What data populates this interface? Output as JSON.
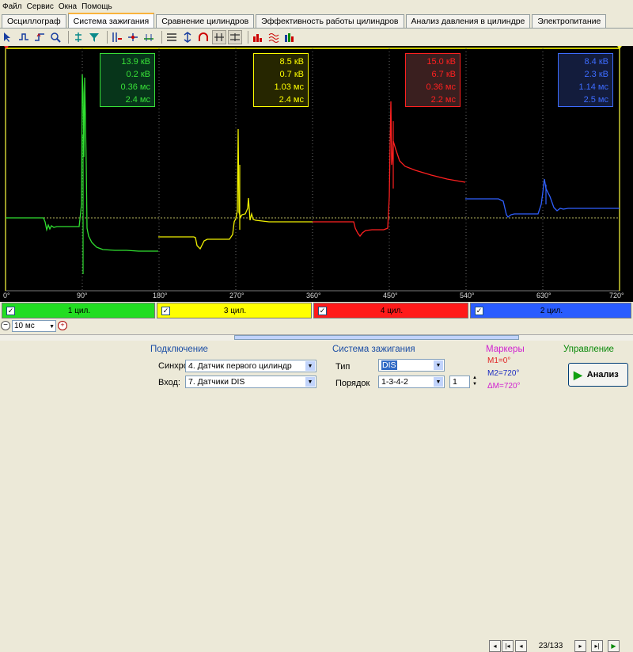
{
  "menu": [
    "Файл",
    "Сервис",
    "Окна",
    "Помощь"
  ],
  "tabs": [
    "Осциллограф",
    "Система зажигания",
    "Сравнение цилиндров",
    "Эффективность работы цилиндров",
    "Анализ давления в цилиндре",
    "Электропитание"
  ],
  "active_tab": 1,
  "measurements": [
    {
      "color": "#38e038",
      "lines": [
        "13.9 кВ",
        "0.2 кВ",
        "0.36 мс",
        "2.4 мс"
      ]
    },
    {
      "color": "#ffff00",
      "lines": [
        "8.5 кВ",
        "0.7 кВ",
        "1.03 мс",
        "2.4 мс"
      ]
    },
    {
      "color": "#ff2020",
      "lines": [
        "15.0 кВ",
        "6.7 кВ",
        "0.36 мс",
        "2.2 мс"
      ]
    },
    {
      "color": "#3d6cff",
      "lines": [
        "8.4 кВ",
        "2.3 кВ",
        "1.14 мс",
        "2.5 мс"
      ]
    }
  ],
  "angle_labels": [
    "0°",
    "90°",
    "180°",
    "270°",
    "360°",
    "450°",
    "540°",
    "630°",
    "720°"
  ],
  "cylinders": [
    {
      "label": "1 цил.",
      "color": "#22dd22"
    },
    {
      "label": "3 цил.",
      "color": "#ffff00"
    },
    {
      "label": "4 цил.",
      "color": "#ff1a1a"
    },
    {
      "label": "2 цил.",
      "color": "#2a5cff"
    }
  ],
  "timebase": "10 мс",
  "frame_counter": "23/133",
  "connection": {
    "title": "Подключение",
    "sync_label": "Синхро:",
    "sync_value": "4. Датчик первого цилиндр",
    "input_label": "Вход:",
    "input_value": "7. Датчики DIS"
  },
  "ignition": {
    "title": "Система зажигания",
    "type_label": "Тип",
    "type_value": "DIS",
    "order_label": "Порядок",
    "order_value": "1-3-4-2",
    "order_num": "1"
  },
  "markers": {
    "title": "Маркеры",
    "m1": "M1=0°",
    "m2": "M2=720°",
    "dm": "ΔM=720°"
  },
  "control": {
    "title": "Управление",
    "analyze": "Анализ"
  }
}
